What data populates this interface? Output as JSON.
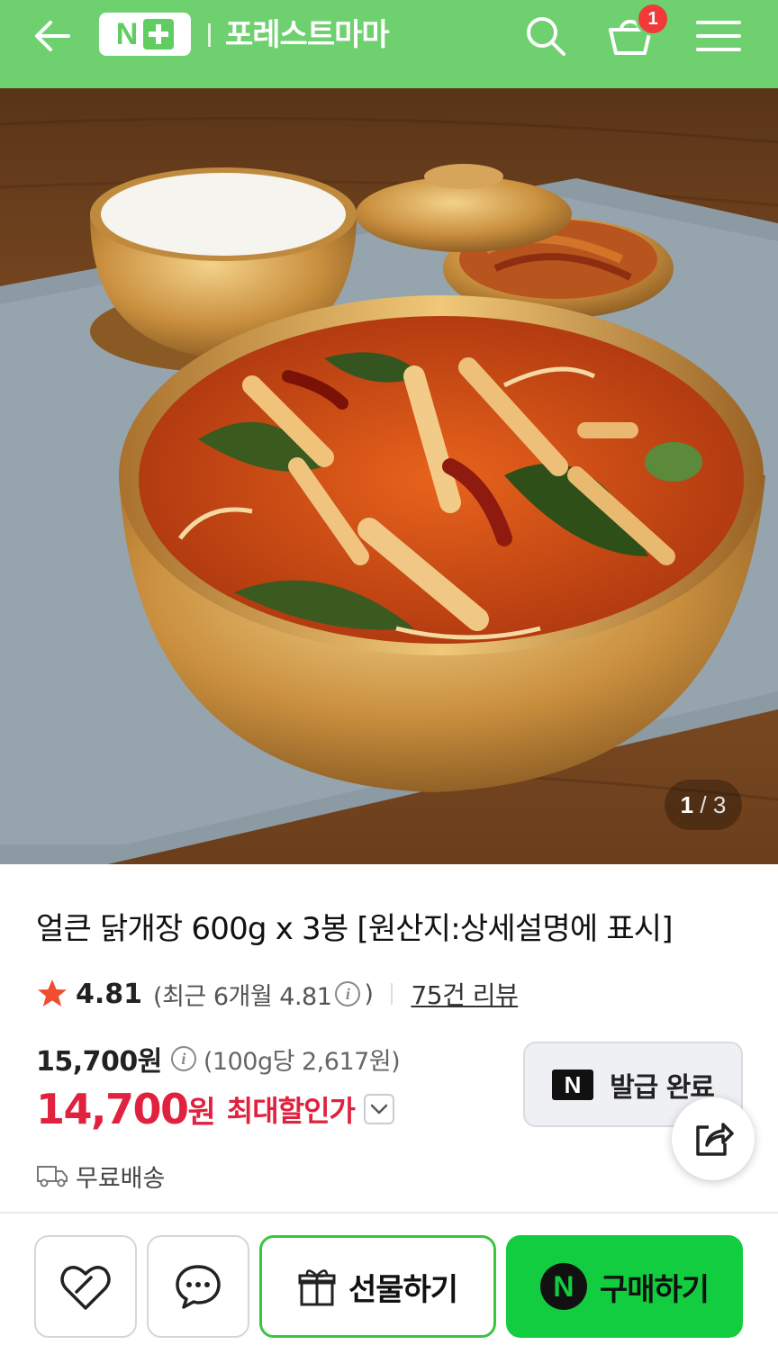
{
  "header": {
    "logo_text": "N",
    "store_name": "포레스트마마",
    "cart_count": "1",
    "icons": [
      "back-arrow-icon",
      "search-icon",
      "cart-basket-icon",
      "menu-icon"
    ]
  },
  "gallery": {
    "current": "1",
    "separator": "/",
    "total": "3"
  },
  "product": {
    "title": "얼큰 닭개장 600g x 3봉 [원산지:상세설명에 표시]",
    "rating": "4.81",
    "recent_rating_open": "(최근 6개월 4.81",
    "recent_rating_close": ")",
    "review_count": "75건 리뷰",
    "original_price": "15,700원",
    "unit_price": "(100g당 2,617원)",
    "sale_price": "14,700",
    "sale_currency": "원",
    "discount_label": "최대할인가",
    "shipping": "무료배송"
  },
  "coupon": {
    "n_mark": "N",
    "label": "발급 완료"
  },
  "bottom_bar": {
    "gift_label": "선물하기",
    "buy_n_mark": "N",
    "buy_label": "구매하기"
  },
  "colors": {
    "header_bg": "#6fd06f",
    "sale_red": "#e0223f",
    "buy_green": "#12cd3f",
    "gift_border": "#38c63f",
    "star": "#f04e2f"
  }
}
